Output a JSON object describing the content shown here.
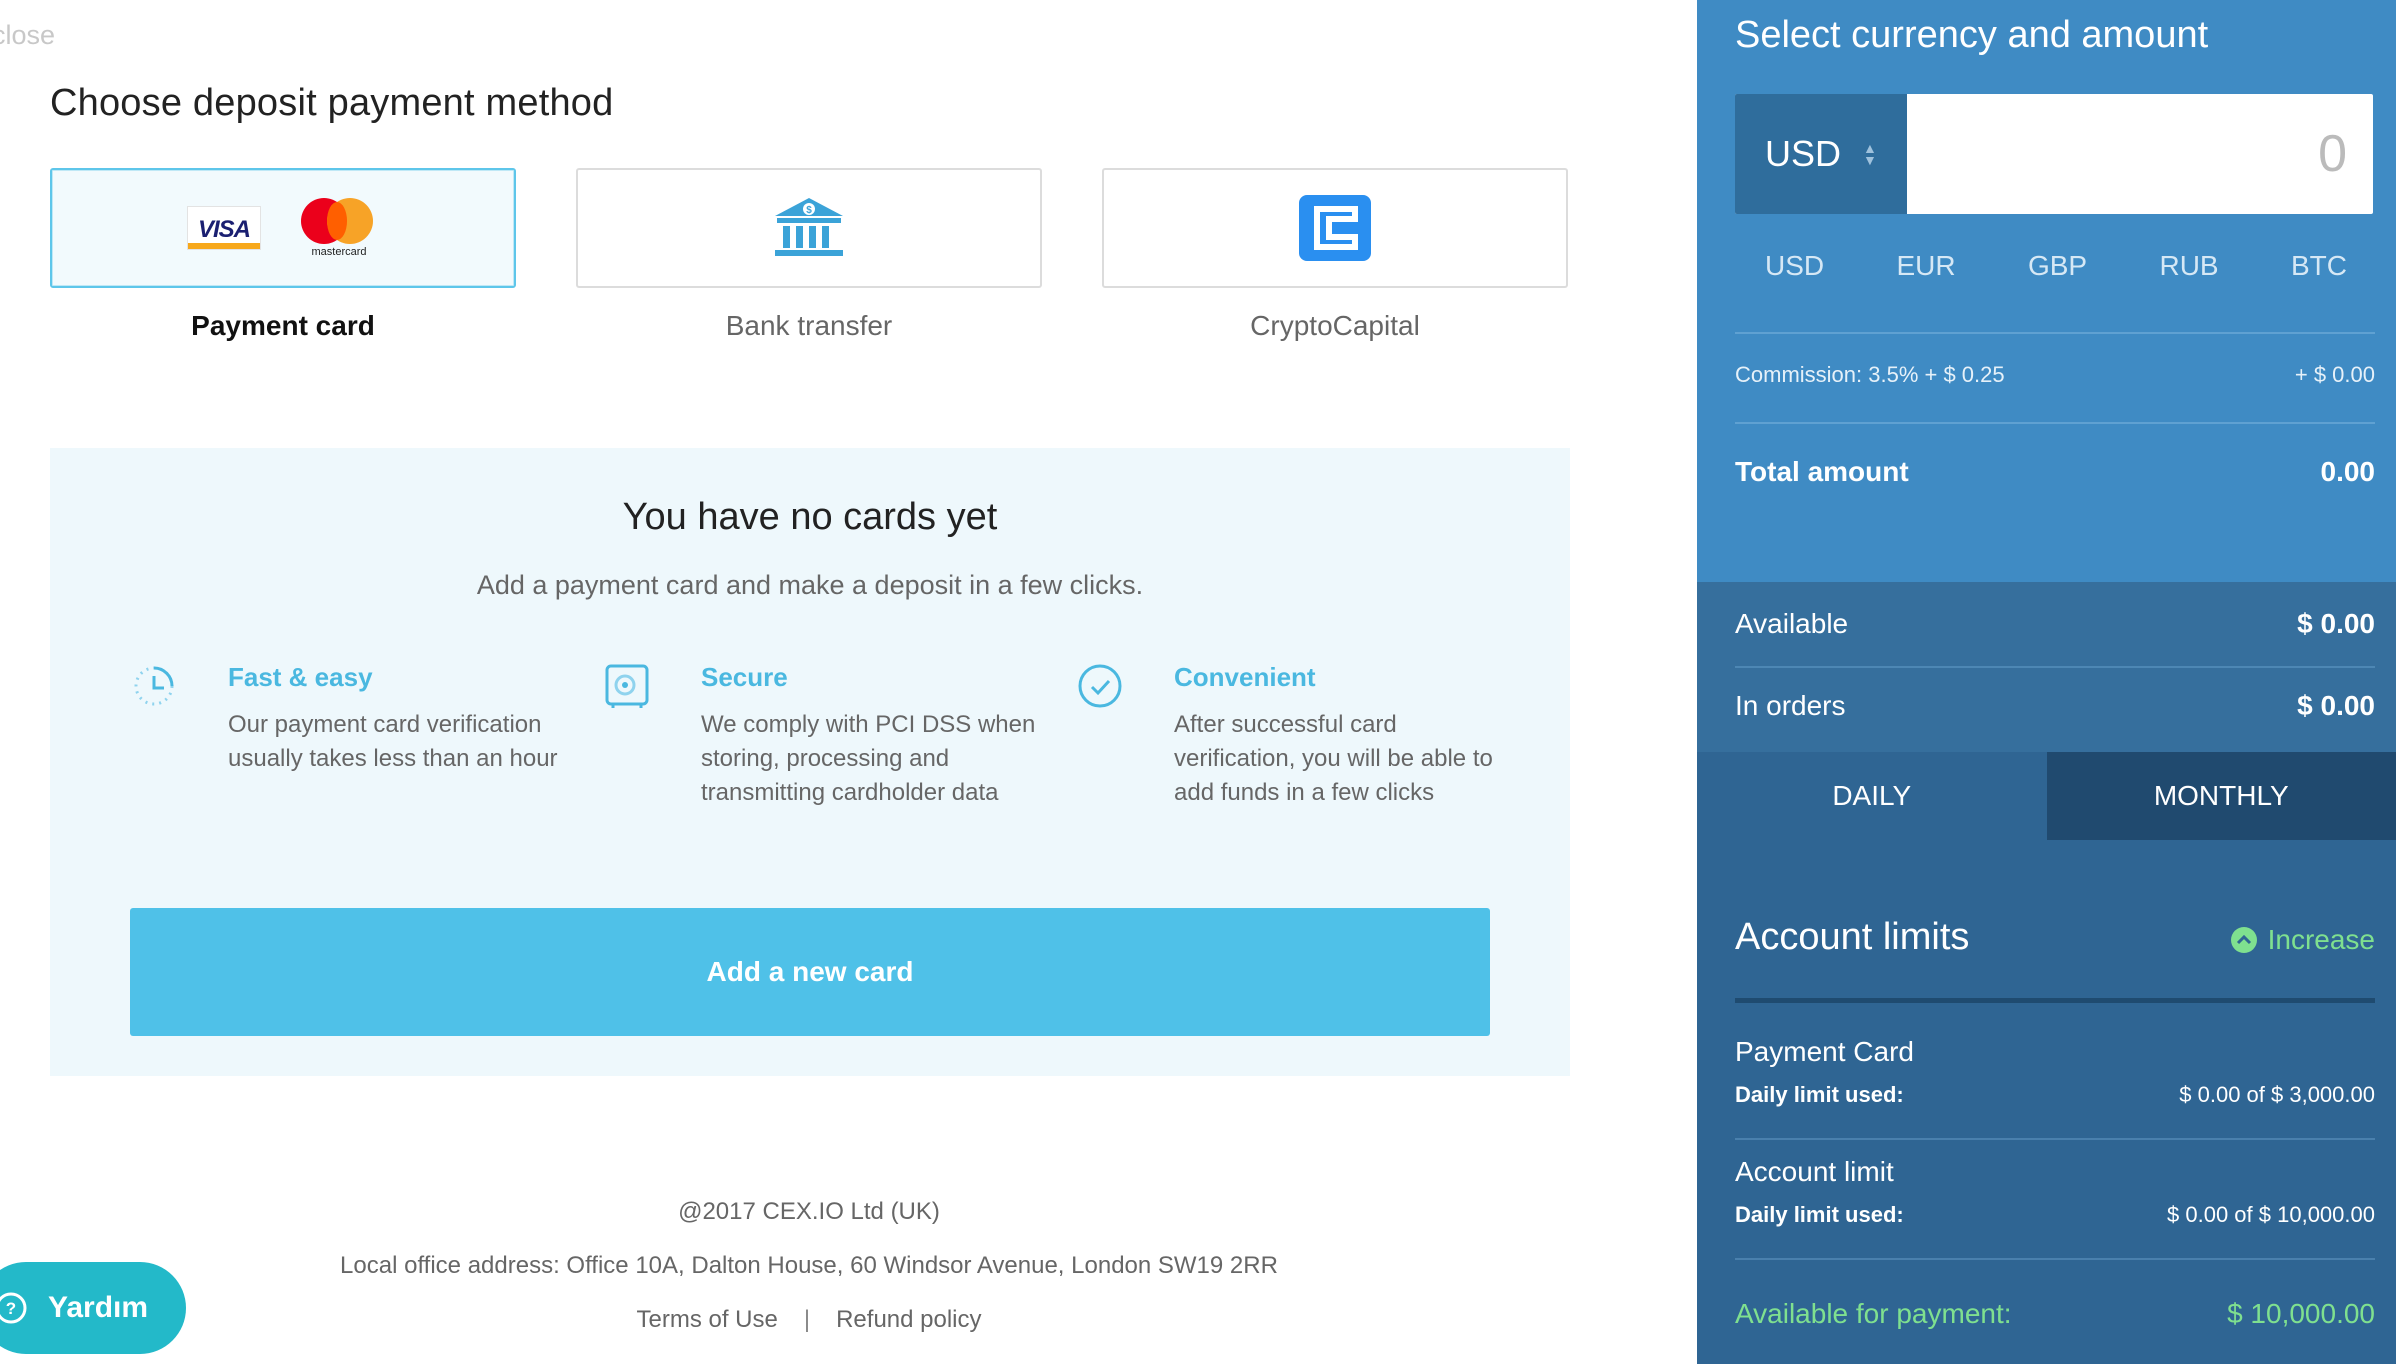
{
  "main": {
    "close_label": "close",
    "title": "Choose deposit payment method",
    "methods": [
      {
        "label": "Payment card",
        "active": true,
        "icon": "visa-mastercard-icon"
      },
      {
        "label": "Bank transfer",
        "active": false,
        "icon": "bank-icon"
      },
      {
        "label": "CryptoCapital",
        "active": false,
        "icon": "cryptocapital-icon"
      }
    ],
    "visa_text": "VISA",
    "mastercard_text": "mastercard",
    "empty": {
      "title": "You have no cards yet",
      "subtitle": "Add a payment card and make a deposit in a few clicks."
    },
    "features": [
      {
        "title": "Fast & easy",
        "desc": "Our payment card verification usually takes less than an hour",
        "icon": "clock-icon"
      },
      {
        "title": "Secure",
        "desc": "We comply with PCI DSS when storing, processing and transmitting cardholder data",
        "icon": "safe-icon"
      },
      {
        "title": "Convenient",
        "desc": "After successful card verification, you will be able to add funds in a few clicks",
        "icon": "check-circle-icon"
      }
    ],
    "add_card_label": "Add a new card",
    "footer": {
      "copyright": "@2017 CEX.IO Ltd (UK)",
      "address": "Local office address: Office 10A, Dalton House, 60 Windsor Avenue, London SW19 2RR",
      "terms": "Terms of Use",
      "separator": "|",
      "refund": "Refund policy"
    },
    "help_label": "Yardım"
  },
  "sidebar": {
    "title": "Select currency and amount",
    "selected_currency": "USD",
    "amount_value": "0",
    "currencies": [
      "USD",
      "EUR",
      "GBP",
      "RUB",
      "BTC"
    ],
    "commission_label": "Commission: 3.5% + $ 0.25",
    "commission_value": "+ $ 0.00",
    "total_label": "Total amount",
    "total_value": "0.00",
    "available_label": "Available",
    "available_value": "$ 0.00",
    "in_orders_label": "In orders",
    "in_orders_value": "$ 0.00",
    "period_tabs": [
      "DAILY",
      "MONTHLY"
    ],
    "limits_title": "Account limits",
    "increase_label": "Increase",
    "limits": [
      {
        "name": "Payment Card",
        "key": "Daily limit used:",
        "value": "$ 0.00 of $ 3,000.00"
      },
      {
        "name": "Account limit",
        "key": "Daily limit used:",
        "value": "$ 0.00 of $ 10,000.00"
      }
    ],
    "available_payment_label": "Available for payment:",
    "available_payment_value": "$ 10,000.00"
  },
  "colors": {
    "accent": "#4fc1e8",
    "sidebar": "#3f8bc4",
    "sidebar_dark": "#2f6593",
    "success": "#7fe08f"
  }
}
